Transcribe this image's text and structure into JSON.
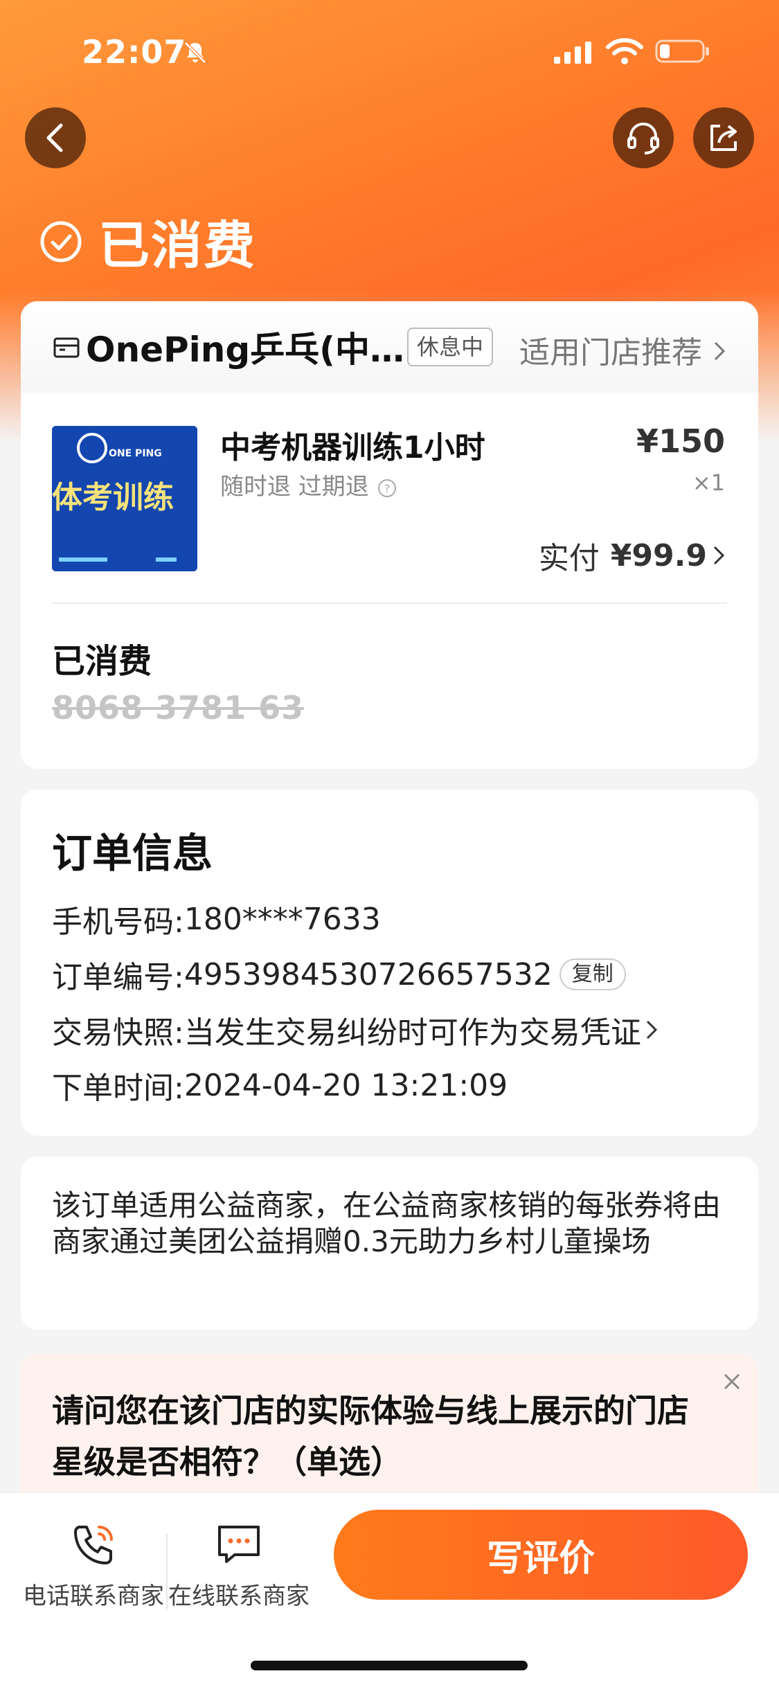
{
  "status_bar": {
    "time": "22:07"
  },
  "header": {
    "status_title": "已消费"
  },
  "shop": {
    "name": "OnePing乒乓(中…",
    "badge": "休息中",
    "recommend": "适用门店推荐"
  },
  "product": {
    "title": "中考机器训练1小时",
    "tags": "随时退 过期退",
    "image_text_logo": "ONE PING",
    "image_text_main": "体考训练",
    "price": "¥150",
    "qty": "×1",
    "paid_label": "实付",
    "paid_amount": "¥99.9"
  },
  "voucher": {
    "status": "已消费",
    "code": "8068 3781 63"
  },
  "order_info": {
    "title": "订单信息",
    "rows": [
      {
        "label": "手机号码:",
        "value": "180****7633"
      },
      {
        "label": "订单编号:",
        "value": "4953984530726657532",
        "action": "复制"
      },
      {
        "label": "交易快照:",
        "value": "当发生交易纠纷时可作为交易凭证"
      },
      {
        "label": "下单时间:",
        "value": "2024-04-20 13:21:09"
      }
    ]
  },
  "charity": {
    "text": "该订单适用公益商家，在公益商家核销的每张券将由商家通过美团公益捐赠0.3元助力乡村儿童操场"
  },
  "survey": {
    "question": "请问您在该门店的实际体验与线上展示的门店星级是否相符？（单选）"
  },
  "bottom_bar": {
    "phone_label": "电话联系商家",
    "online_label": "在线联系商家",
    "review_button": "写评价"
  },
  "colors": {
    "accent": "#ff7a1a",
    "hero": "#ff8a3a"
  }
}
